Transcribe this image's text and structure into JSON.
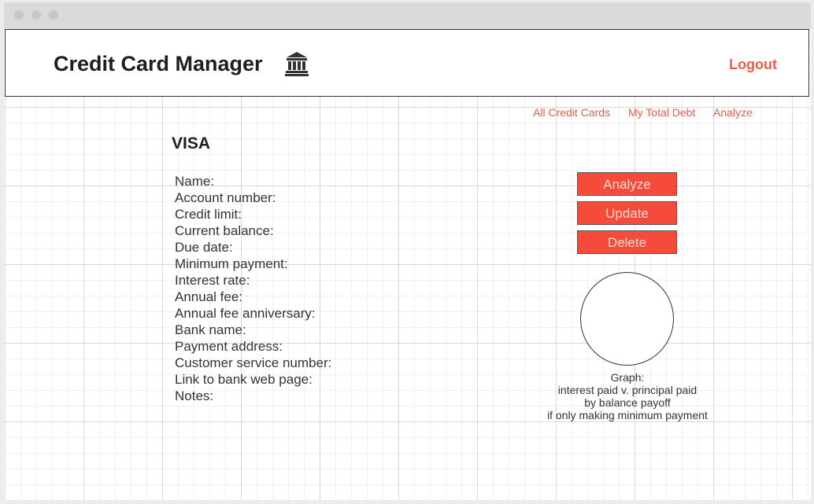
{
  "header": {
    "title": "Credit Card Manager",
    "icon": "bank-icon",
    "logout_label": "Logout"
  },
  "nav": {
    "all_cards": "All Credit Cards",
    "total_debt": "My Total Debt",
    "analyze": "Analyze"
  },
  "card": {
    "name": "VISA",
    "fields": [
      "Name:",
      "Account number:",
      "Credit limit:",
      "Current balance:",
      "Due date:",
      "Minimum payment:",
      "Interest rate:",
      "Annual fee:",
      "Annual fee anniversary:",
      "Bank name:",
      "Payment address:",
      "Customer service number:",
      "Link to bank web page:",
      "Notes:"
    ]
  },
  "actions": {
    "analyze_label": "Analyze",
    "update_label": "Update",
    "delete_label": "Delete"
  },
  "graph": {
    "caption_lines": [
      "Graph:",
      "interest paid v. principal paid",
      "by balance payoff",
      "if only making minimum payment"
    ]
  },
  "colors": {
    "accent": "#f05a44",
    "button_bg": "#f44b3a",
    "button_text": "#ffd9d3"
  }
}
